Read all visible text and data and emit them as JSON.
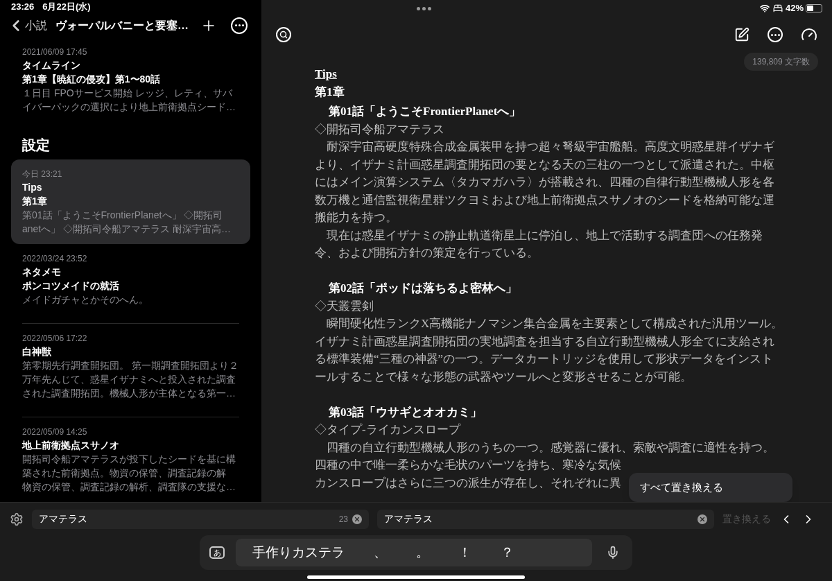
{
  "status_bar": {
    "time": "23:26",
    "date": "6月22日(水)",
    "battery": "42%"
  },
  "sidebar": {
    "back_label": "小説",
    "title": "ヴォーパルバニーと要塞…",
    "sections": [
      {
        "items": [
          {
            "date": "2021/06/09 17:45",
            "title": "タイムライン",
            "subtitle": "第1章【暁紅の侵攻】第1〜80話",
            "preview": [
              "１日目 FPOサービス開始 レッジ、レティ、サバ",
              "イバーパックの選択により地上前衛拠点シード…"
            ],
            "selected": false
          }
        ]
      },
      {
        "header": "設定",
        "items": [
          {
            "date": "今日 23:21",
            "title": "Tips",
            "subtitle": "第1章",
            "preview": [
              "第01話「ようこそFrontierPlanetへ」 ◇開拓司",
              "anetへ」 ◇開拓司令船アマテラス 耐深宇宙高…"
            ],
            "selected": true
          },
          {
            "date": "2022/03/24 23:52",
            "title": "ネタメモ",
            "subtitle": "ポンコツメイドの就活",
            "preview": [
              "メイドガチャとかそのへん。"
            ],
            "selected": false
          },
          {
            "date": "2022/05/06 17:22",
            "title": "白神獣",
            "preview": [
              "第零期先行調査開拓団。 第一期調査開拓団より２",
              "万年先んじて、惑星イザナミへと投入された調査",
              "された調査開拓団。機械人形が主体となる第一…"
            ],
            "selected": false
          },
          {
            "date": "2022/05/09 14:25",
            "title": "地上前衛拠点スサノオ",
            "preview": [
              "開拓司令船アマテラスが投下したシードを基に構",
              "築された前衛拠点。物資の保管、調査記録の解",
              "物資の保管、調査記録の解析、調査隊の支援な…"
            ],
            "selected": false
          }
        ]
      }
    ]
  },
  "editor": {
    "word_count": "139,809 文字数",
    "blocks": [
      {
        "kind": "title",
        "text": "Tips"
      },
      {
        "kind": "chapter",
        "text": "第1章"
      },
      {
        "kind": "episode",
        "text": "第01話「ようこそFrontierPlanetへ」"
      },
      {
        "kind": "item",
        "text": "◇開拓司令船アマテラス"
      },
      {
        "kind": "paragraph",
        "lines": [
          "耐深宇宙高硬度特殊合成金属装甲を持つ超々弩級宇宙艦船。高度文明惑星群イザナギ",
          "より、イザナミ計画惑星調査開拓団の要となる天の三柱の一つとして派遣された。中枢",
          "にはメイン演算システム〈タカマガハラ〉が搭載され、四種の自律行動型機械人形を各",
          "数万機と通信監視衛星群ツクヨミおよび地上前衛拠点スサノオのシードを格納可能な運",
          "搬能力を持つ。"
        ]
      },
      {
        "kind": "paragraph",
        "lines": [
          "現在は惑星イザナミの静止軌道衛星上に停泊し、地上で活動する調査団への任務発",
          "令、および開拓方針の策定を行っている。"
        ]
      },
      {
        "kind": "episode",
        "text": "第02話「ポッドは落ちるよ密林へ」"
      },
      {
        "kind": "item",
        "text": "◇天叢雲剣"
      },
      {
        "kind": "paragraph",
        "lines": [
          "瞬間硬化性ランクX高機能ナノマシン集合金属を主要素として構成された汎用ツール。",
          "イザナミ計画惑星調査開拓団の実地調査を担当する自立行動型機械人形全てに支給され",
          "る標準装備“三種の神器”の一つ。データカートリッジを使用して形状データをインスト",
          "ールすることで様々な形態の武器やツールへと変形させることが可能。"
        ]
      },
      {
        "kind": "episode",
        "text": "第03話「ウサギとオオカミ」"
      },
      {
        "kind": "item",
        "text": "◇タイプ-ライカンスロープ"
      },
      {
        "kind": "paragraph",
        "lines": [
          "四種の自立行動型機械人形のうちの一つ。感覚器に優れ、索敵や調査に適性を持つ。",
          "四種の中で唯一柔らかな毛状のパーツを持ち、寒冷な気候",
          "カンスロープはさらに三つの派生が存在し、それぞれに異"
        ]
      }
    ]
  },
  "replace_menu": {
    "label": "すべて置き換える"
  },
  "find_bar": {
    "find_value": "アマテラス",
    "match_count": "23",
    "replace_value": "アマテラス",
    "replace_button": {
      "label": "置き換える",
      "disabled": true
    }
  },
  "keyboard_bar": {
    "input_key": "あ",
    "candidates": [
      "手作りカステラ",
      "、",
      "。",
      "！",
      "？"
    ]
  }
}
